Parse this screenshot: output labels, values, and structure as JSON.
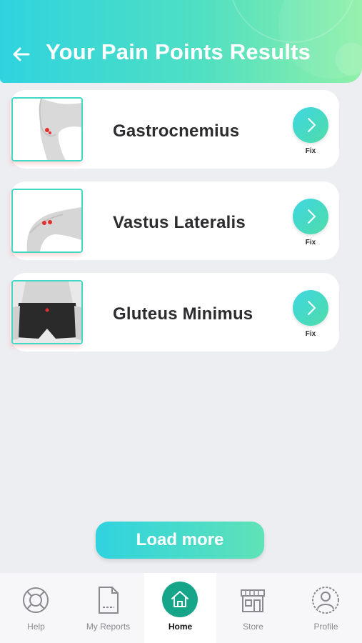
{
  "header": {
    "title": "Your Pain Points Results",
    "back_icon": "arrow-left-icon"
  },
  "results": [
    {
      "name": "Gastrocnemius",
      "fix_label": "Fix",
      "image": "knee-back-image"
    },
    {
      "name": "Vastus Lateralis",
      "fix_label": "Fix",
      "image": "thigh-side-image"
    },
    {
      "name": "Gluteus Minimus",
      "fix_label": "Fix",
      "image": "hip-image"
    }
  ],
  "load_more_label": "Load more",
  "tabbar": {
    "active": "Home",
    "items": [
      {
        "label": "Help",
        "icon": "lifebuoy-icon"
      },
      {
        "label": "My Reports",
        "icon": "report-icon"
      },
      {
        "label": "Home",
        "icon": "home-icon"
      },
      {
        "label": "Store",
        "icon": "store-icon"
      },
      {
        "label": "Profile",
        "icon": "profile-icon"
      }
    ]
  },
  "colors": {
    "accent_start": "#2fd3df",
    "accent_end": "#8ff0a8",
    "home_active": "#17a58a",
    "background": "#edeef2"
  }
}
